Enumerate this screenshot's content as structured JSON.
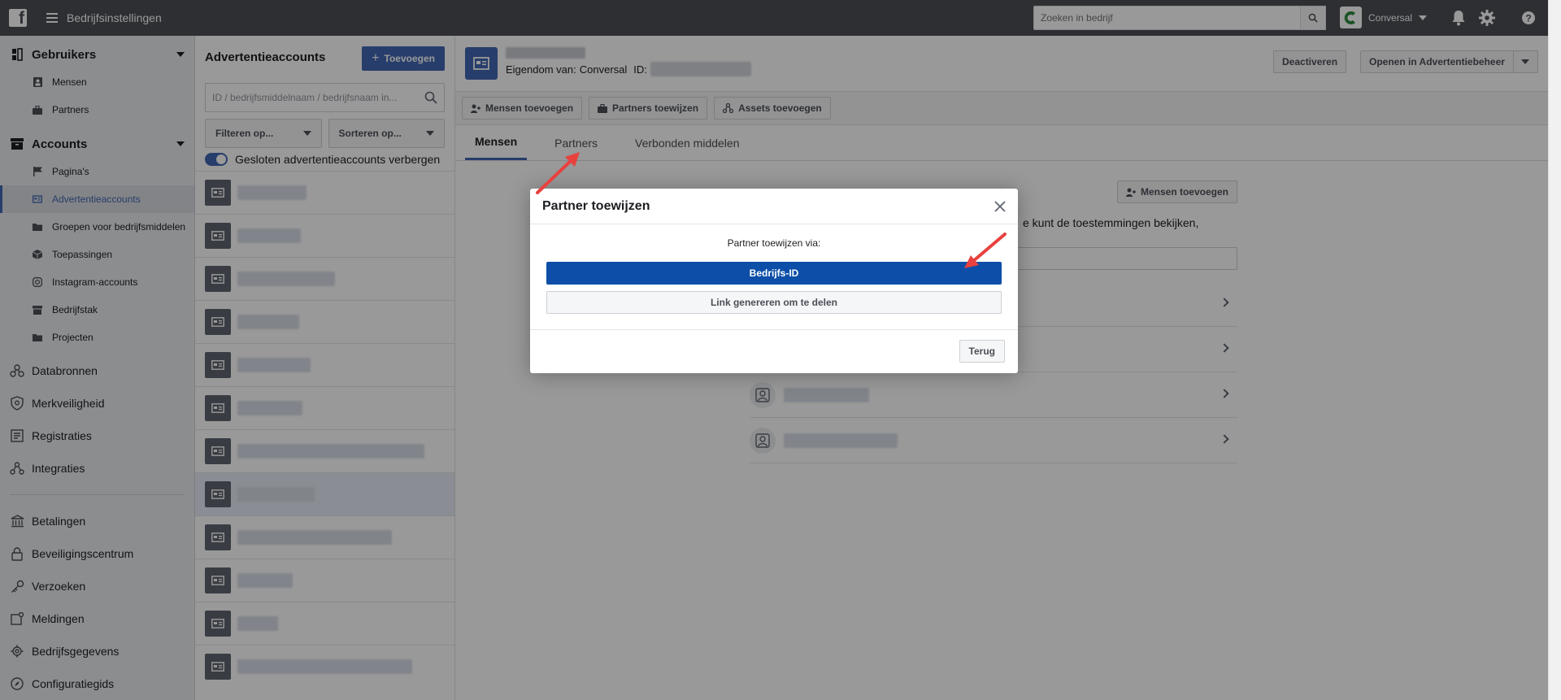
{
  "topbar": {
    "app_title": "Bedrijfsinstellingen",
    "search_placeholder": "Zoeken in bedrijf",
    "account_name": "Conversal",
    "logo_letter": "f"
  },
  "sidebar": {
    "sections": [
      {
        "label": "Gebruikers",
        "icon": "users-icon",
        "items": [
          {
            "label": "Mensen",
            "icon": "person-icon"
          },
          {
            "label": "Partners",
            "icon": "briefcase-icon"
          }
        ]
      },
      {
        "label": "Accounts",
        "icon": "archive-icon",
        "items": [
          {
            "label": "Pagina's",
            "icon": "flag-icon"
          },
          {
            "label": "Advertentieaccounts",
            "icon": "ad-account-icon"
          },
          {
            "label": "Groepen voor bedrijfsmiddelen",
            "icon": "folder-icon"
          },
          {
            "label": "Toepassingen",
            "icon": "cube-icon"
          },
          {
            "label": "Instagram-accounts",
            "icon": "instagram-icon"
          },
          {
            "label": "Bedrijfstak",
            "icon": "store-icon"
          },
          {
            "label": "Projecten",
            "icon": "folder-icon"
          }
        ]
      }
    ],
    "collapsed": [
      {
        "label": "Databronnen",
        "icon": "data-sources-icon"
      },
      {
        "label": "Merkveiligheid",
        "icon": "shield-icon"
      },
      {
        "label": "Registraties",
        "icon": "registrations-icon"
      },
      {
        "label": "Integraties",
        "icon": "integrations-icon"
      }
    ],
    "bottom": [
      {
        "label": "Betalingen",
        "icon": "bank-icon"
      },
      {
        "label": "Beveiligingscentrum",
        "icon": "lock-icon"
      },
      {
        "label": "Verzoeken",
        "icon": "key-icon"
      },
      {
        "label": "Meldingen",
        "icon": "notification-icon"
      },
      {
        "label": "Bedrijfsgegevens",
        "icon": "gear-icon"
      },
      {
        "label": "Configuratiegids",
        "icon": "compass-icon"
      }
    ]
  },
  "list": {
    "title": "Advertentieaccounts",
    "add_label": "Toevoegen",
    "search_placeholder": "ID / bedrijfsmiddelnaam / bedrijfsnaam in...",
    "filter_label": "Filteren op...",
    "sort_label": "Sorteren op...",
    "toggle_label": "Gesloten advertentieaccounts verbergen"
  },
  "detail": {
    "owner_prefix": "Eigendom van:",
    "owner_name": "Conversal",
    "id_label": "ID:",
    "deactivate_label": "Deactiveren",
    "open_label": "Openen in Advertentiebeheer",
    "actions": [
      "Mensen toevoegen",
      "Partners toewijzen",
      "Assets toevoegen"
    ],
    "tabs": [
      "Mensen",
      "Partners",
      "Verbonden middelen"
    ],
    "panel_button": "Mensen toevoegen",
    "panel_text_fragment": "e kunt de toestemmingen bekijken,"
  },
  "modal": {
    "title": "Partner toewijzen",
    "label": "Partner toewijzen via:",
    "primary_label": "Bedrijfs-ID",
    "secondary_label": "Link genereren om te delen",
    "back_label": "Terug"
  }
}
